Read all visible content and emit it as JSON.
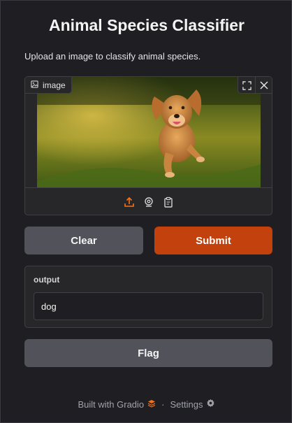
{
  "app": {
    "title": "Animal Species Classifier",
    "description": "Upload an image to classify animal species."
  },
  "image_input": {
    "label": "image",
    "icons": [
      "image-icon",
      "fullscreen-icon",
      "close-icon"
    ],
    "sources": [
      "upload-icon",
      "webcam-icon",
      "clipboard-icon"
    ]
  },
  "buttons": {
    "clear": "Clear",
    "submit": "Submit",
    "flag": "Flag"
  },
  "output": {
    "label": "output",
    "value": "dog"
  },
  "footer": {
    "built_with": "Built with Gradio",
    "separator": "·",
    "settings": "Settings"
  },
  "colors": {
    "accent": "#c2410c",
    "secondary_button": "#52525b",
    "background": "#1f1f23",
    "panel": "#27272a"
  }
}
